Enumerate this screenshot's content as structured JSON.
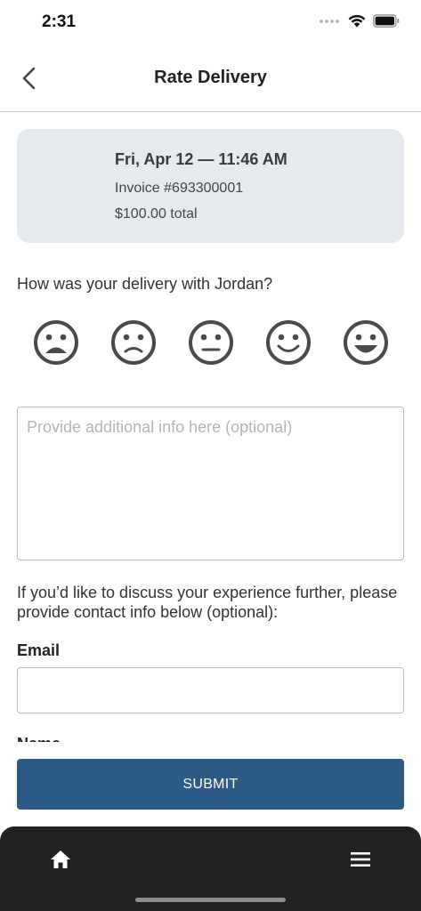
{
  "status_bar": {
    "time": "2:31"
  },
  "header": {
    "title": "Rate Delivery",
    "back_icon": "chevron-left-icon"
  },
  "delivery_card": {
    "date": "Fri, Apr 12 — 11:46 AM",
    "invoice": "Invoice #693300001",
    "total": "$100.00 total"
  },
  "rating": {
    "question": "How was your delivery with Jordan?",
    "faces": [
      "very-sad-face-icon",
      "sad-face-icon",
      "neutral-face-icon",
      "smile-face-icon",
      "grin-face-icon"
    ]
  },
  "comments": {
    "placeholder": "Provide additional info here (optional)",
    "value": ""
  },
  "contact": {
    "note": "If you’d like to discuss your experience further, please provide contact info below (optional):",
    "email_label": "Email",
    "email_value": "",
    "name_label": "Name"
  },
  "submit": {
    "label": "SUBMIT"
  },
  "tab_bar": {
    "home_icon": "home-icon",
    "menu_icon": "hamburger-menu-icon"
  },
  "colors": {
    "accent": "#2d5a85",
    "card_background": "#e6e9ee",
    "tab_bar_background": "#222222",
    "face_icon": "#4a4a4a"
  }
}
